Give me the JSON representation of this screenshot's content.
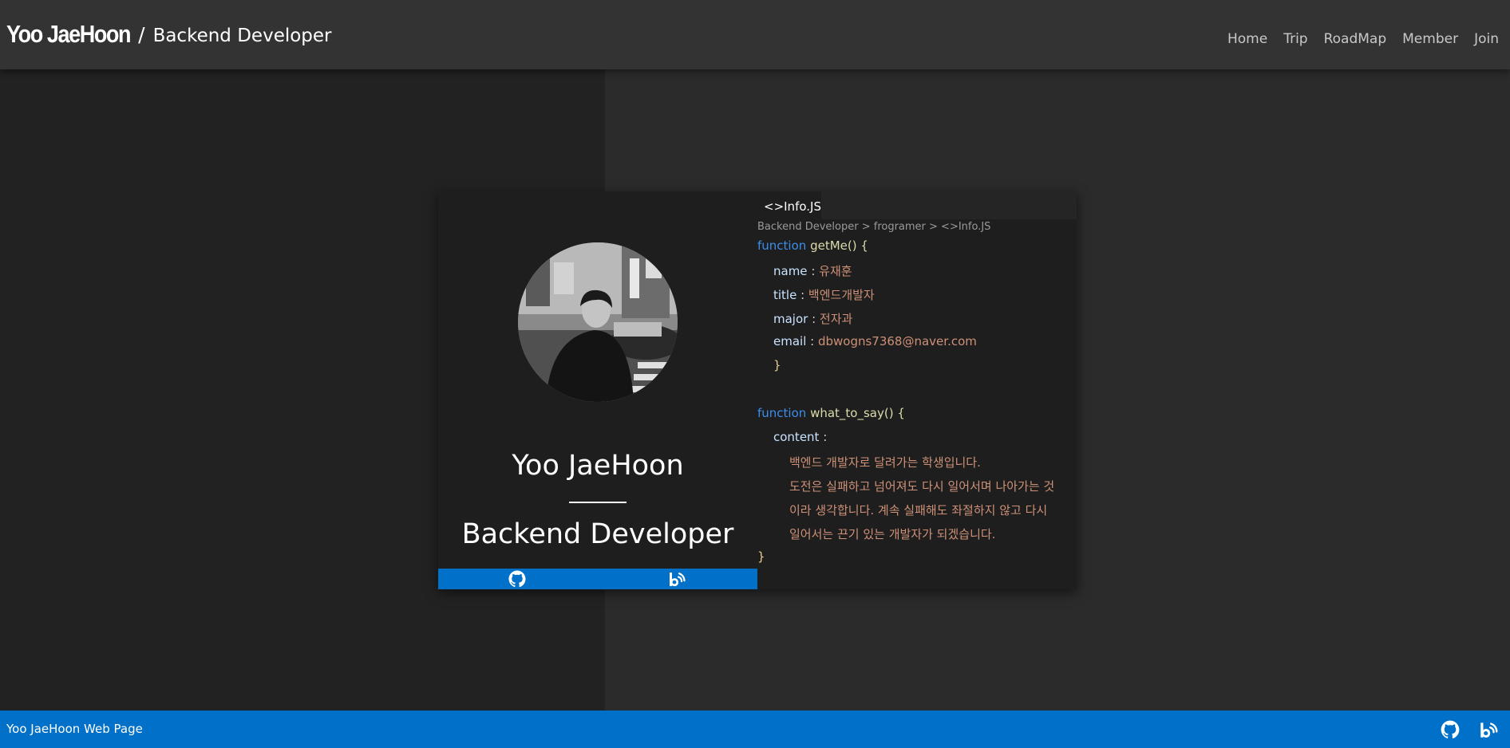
{
  "header": {
    "brand_name": "Yoo JaeHoon",
    "separator": "/",
    "role": "Backend Developer",
    "nav": [
      "Home",
      "Trip",
      "RoadMap",
      "Member",
      "Join"
    ]
  },
  "profile": {
    "name": "Yoo JaeHoon",
    "role": "Backend Developer",
    "social_icons": [
      "github-icon",
      "blog-icon"
    ]
  },
  "code": {
    "tab": "<>Info.JS",
    "breadcrumb": "Backend Developer > frogramer > <>Info.JS",
    "fn1": {
      "keyword": "function",
      "name": "getMe() {"
    },
    "fields": [
      {
        "key": "name",
        "sep": " : ",
        "value": "유재훈"
      },
      {
        "key": "title",
        "sep": " : ",
        "value": "백엔드개발자"
      },
      {
        "key": "major",
        "sep": " : ",
        "value": "전자과"
      },
      {
        "key": "email",
        "sep": " : ",
        "value": "dbwogns7368@naver.com"
      }
    ],
    "close1": "}",
    "fn2": {
      "keyword": "function",
      "name": "what_to_say() {"
    },
    "content_key": "content",
    "content_sep": " :",
    "content_lines": [
      "백엔드 개발자로 달려가는 학생입니다.",
      "도전은 실패하고 넘어져도 다시 일어서며 나아가는 것",
      "이라 생각합니다. 계속 실패해도 좌절하지 않고 다시",
      "일어서는 끈기 있는 개발자가 되겠습니다."
    ],
    "close2": "}"
  },
  "footer": {
    "text": "Yoo JaeHoon Web Page",
    "icons": [
      "github-icon",
      "blog-icon"
    ]
  },
  "colors": {
    "header_bg": "#333333",
    "accent_blue": "#0070c8",
    "keyword": "#3b8eea",
    "function_name": "#dcdcaa",
    "string": "#ce9178"
  }
}
